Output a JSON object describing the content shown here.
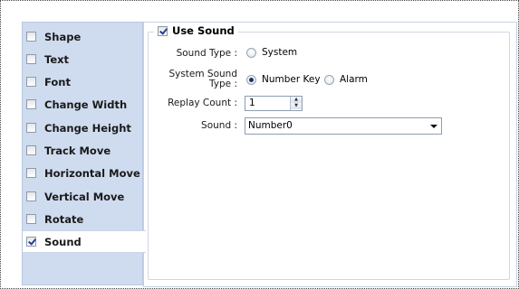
{
  "sidebar": {
    "items": [
      {
        "label": "Shape",
        "checked": false
      },
      {
        "label": "Text",
        "checked": false
      },
      {
        "label": "Font",
        "checked": false
      },
      {
        "label": "Change Width",
        "checked": false
      },
      {
        "label": "Change Height",
        "checked": false
      },
      {
        "label": "Track Move",
        "checked": false
      },
      {
        "label": "Horizontal Move",
        "checked": false
      },
      {
        "label": "Vertical Move",
        "checked": false
      },
      {
        "label": "Rotate",
        "checked": false
      },
      {
        "label": "Sound",
        "checked": true,
        "active": true
      }
    ]
  },
  "panel": {
    "group_title": "Use Sound",
    "group_checked": true,
    "sound_type": {
      "label": "Sound Type :",
      "options": [
        {
          "label": "System",
          "selected": false
        }
      ]
    },
    "system_sound_type": {
      "label_line1": "System Sound",
      "label_line2": "Type :",
      "options": [
        {
          "label": "Number Key",
          "selected": true
        },
        {
          "label": "Alarm",
          "selected": false
        }
      ]
    },
    "replay_count": {
      "label": "Replay Count :",
      "value": "1"
    },
    "sound": {
      "label": "Sound :",
      "value": "Number0"
    }
  },
  "colors": {
    "sidebar_bg": "#cfdcef",
    "panel_bg": "#ffffff",
    "check_mark": "#2a3d8f"
  }
}
